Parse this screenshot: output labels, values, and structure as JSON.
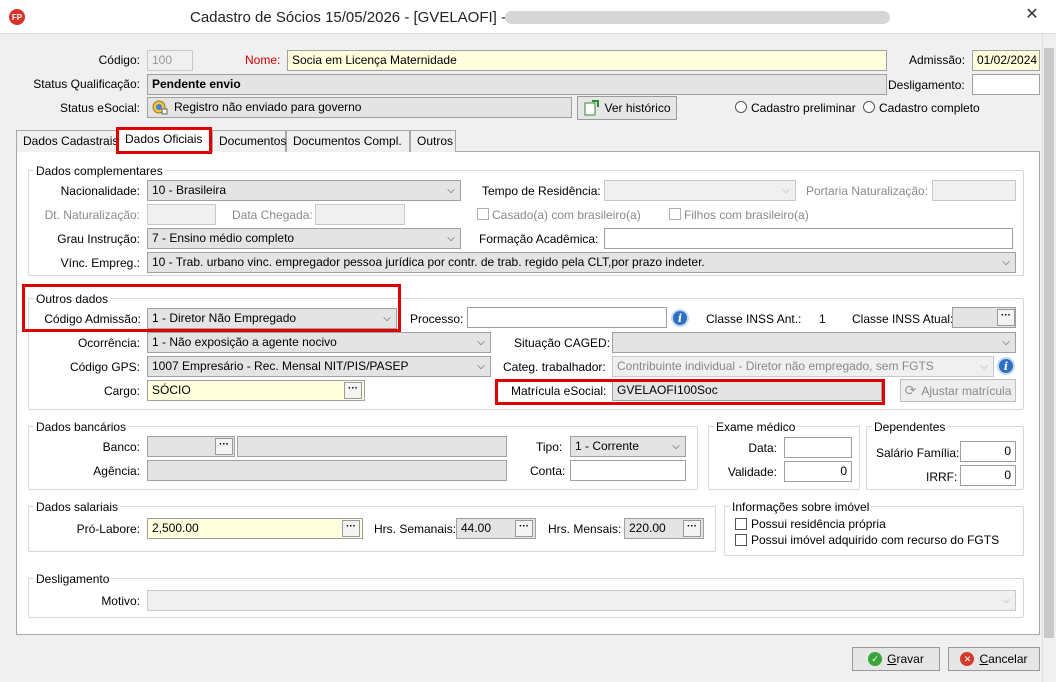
{
  "window": {
    "title": "Cadastro de Sócios  15/05/2026 - [GVELAOFI] -",
    "app_icon_text": "FP",
    "close_glyph": "✕"
  },
  "header": {
    "codigo_label": "Código:",
    "codigo_value": "100",
    "nome_label": "Nome:",
    "nome_value": "Socia em Licença Maternidade",
    "admissao_label": "Admissão:",
    "admissao_value": "01/02/2024",
    "status_qualif_label": "Status Qualificação:",
    "status_qualif_value": "Pendente envio",
    "desligamento_label": "Desligamento:",
    "desligamento_value": "",
    "status_esocial_label": "Status eSocial:",
    "status_esocial_value": "Registro não enviado para governo",
    "ver_historico_label": "Ver histórico",
    "radio_preliminar": "Cadastro preliminar",
    "radio_completo": "Cadastro completo"
  },
  "tabs": [
    {
      "label": "Dados Cadastrais"
    },
    {
      "label": "Dados Oficiais"
    },
    {
      "label": "Documentos"
    },
    {
      "label": "Documentos Compl."
    },
    {
      "label": "Outros"
    }
  ],
  "complementares": {
    "title": "Dados complementares",
    "nacionalidade_label": "Nacionalidade:",
    "nacionalidade_value": "10  -  Brasileira",
    "tempo_residencia_label": "Tempo de Residência:",
    "tempo_residencia_value": "",
    "portaria_label": "Portaria Naturalização:",
    "dt_naturalizacao_label": "Dt. Naturalização:",
    "data_chegada_label": "Data Chegada:",
    "casado_label": "Casado(a) com brasileiro(a)",
    "filhos_label": "Filhos com brasileiro(a)",
    "grau_label": "Grau Instrução:",
    "grau_value": "7  -  Ensino médio completo",
    "formacao_label": "Formação Acadêmica:",
    "formacao_value": "",
    "vinc_label": "Vínc. Empreg.:",
    "vinc_value": "10  -  Trab. urbano vinc.  empregador pessoa jurídica por contr. de trab. regido pela CLT,por prazo indeter."
  },
  "outros": {
    "title": "Outros dados",
    "cod_admissao_label": "Código Admissão:",
    "cod_admissao_value": "1 - Diretor Não Empregado",
    "processo_label": "Processo:",
    "processo_value": "",
    "classe_ant_label": "Classe INSS Ant.:",
    "classe_ant_value": "1",
    "classe_atual_label": "Classe INSS Atual:",
    "classe_atual_value": "",
    "ocorrencia_label": "Ocorrência:",
    "ocorrencia_value": "1 - Não exposição a agente nocivo",
    "situacao_caged_label": "Situação CAGED:",
    "situacao_caged_value": "",
    "codigo_gps_label": "Código GPS:",
    "codigo_gps_value": "1007 Empresário - Rec. Mensal NIT/PIS/PASEP",
    "categ_label": "Categ. trabalhador:",
    "categ_value": "Contribuinte individual - Diretor não empregado, sem FGTS",
    "cargo_label": "Cargo:",
    "cargo_value": "SÓCIO",
    "matricula_label": "Matrícula eSocial:",
    "matricula_value": "GVELAOFI100Soc",
    "ajustar_label": "Ajustar matrícula"
  },
  "bancarios": {
    "title": "Dados bancários",
    "banco_label": "Banco:",
    "agencia_label": "Agência:",
    "tipo_label": "Tipo:",
    "tipo_value": "1 - Corrente",
    "conta_label": "Conta:",
    "conta_value": ""
  },
  "exame": {
    "title": "Exame médico",
    "data_label": "Data:",
    "data_value": "",
    "validade_label": "Validade:",
    "validade_value": "0"
  },
  "dependentes": {
    "title": "Dependentes",
    "salario_familia_label": "Salário Família:",
    "salario_familia_value": "0",
    "irrf_label": "IRRF:",
    "irrf_value": "0"
  },
  "salariais": {
    "title": "Dados salariais",
    "pro_labore_label": "Pró-Labore:",
    "pro_labore_value": "2,500.00",
    "hrs_semanais_label": "Hrs. Semanais:",
    "hrs_semanais_value": "44.00",
    "hrs_mensais_label": "Hrs. Mensais:",
    "hrs_mensais_value": "220.00"
  },
  "imovel": {
    "title": "Informações sobre imóvel",
    "residencia_label": "Possui residência própria",
    "fgts_label": "Possui imóvel adquirido com recurso do FGTS"
  },
  "desligamento": {
    "title": "Desligamento",
    "motivo_label": "Motivo:",
    "motivo_value": ""
  },
  "footer": {
    "gravar_prefix": "",
    "gravar_underline": "G",
    "gravar_rest": "ravar",
    "cancelar_prefix": "",
    "cancelar_underline": "C",
    "cancelar_rest": "ancelar"
  },
  "colors": {
    "highlight": "#e00000",
    "required_label": "#cc0000",
    "field_yellow": "#ffffdd"
  }
}
